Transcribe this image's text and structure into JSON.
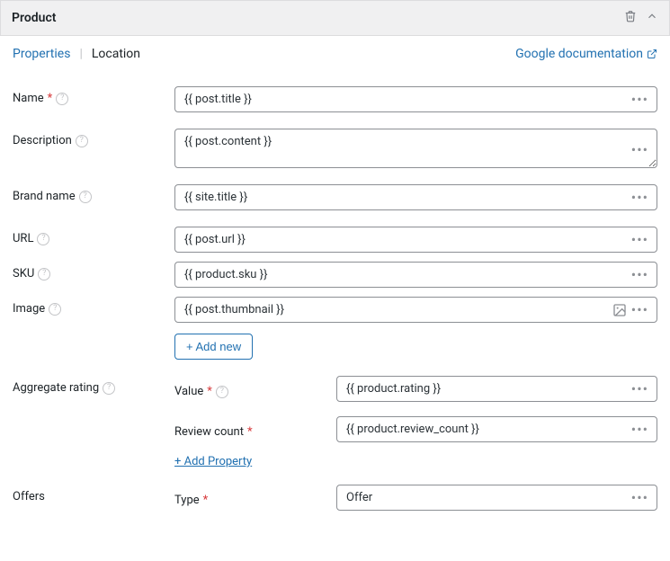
{
  "header": {
    "title": "Product"
  },
  "tabs": {
    "properties": "Properties",
    "location": "Location"
  },
  "doc_link": "Google documentation",
  "fields": {
    "name": {
      "label": "Name",
      "value": "{{ post.title }}"
    },
    "description": {
      "label": "Description",
      "value": "{{ post.content }}"
    },
    "brand_name": {
      "label": "Brand name",
      "value": "{{ site.title }}"
    },
    "url": {
      "label": "URL",
      "value": "{{ post.url }}"
    },
    "sku": {
      "label": "SKU",
      "value": "{{ product.sku }}"
    },
    "image": {
      "label": "Image",
      "value": "{{ post.thumbnail }}",
      "add_new": "+ Add new"
    },
    "aggregate_rating": {
      "label": "Aggregate rating",
      "value": {
        "label": "Value",
        "value": "{{ product.rating }}"
      },
      "review_count": {
        "label": "Review count",
        "value": "{{ product.review_count }}"
      },
      "add_property": "+ Add Property"
    },
    "offers": {
      "label": "Offers",
      "type": {
        "label": "Type",
        "value": "Offer"
      }
    }
  }
}
